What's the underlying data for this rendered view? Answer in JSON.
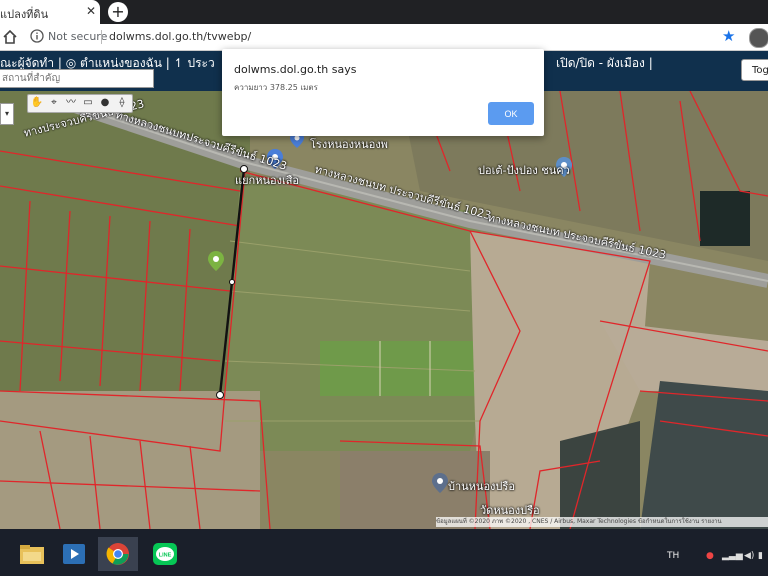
{
  "browser": {
    "tab_title": "แปลงที่ดิน",
    "close_glyph": "✕",
    "newtab_glyph": "+",
    "not_secure": "Not secure",
    "url": "dolwms.dol.go.th/tvwebp/",
    "star_glyph": "★"
  },
  "site_nav": {
    "left_text": "ณะผู้จัดทำ | ◎ ตำแหน่งของฉัน | ↿ ประว",
    "right_text": "เปิด/ปิด - ผังเมือง |",
    "toggle_label": "Tog",
    "search_placeholder": "สถานที่สำคัญ"
  },
  "map": {
    "road_label_1": "ทางหลวงชนบทประจวบคีรีขันธ์ 1023",
    "road_label_2": "ทางหลวงชนบท ประจวบคีรีขันธ์ 1023",
    "road_label_3": "ทางหลวงชนบท ประจวบคีรีขันธ์ 1023",
    "road_label_top": "ทางประจวบคีรีขันธ์ 1023",
    "place_1": "แยกหนองเสือ",
    "place_2": "ปอเต้-ปังปอง ชนคว",
    "place_3": "บ้านหนองปรือ",
    "place_4": "วัดหนองปรือ",
    "place_top": "โรงหนองหนองพ",
    "attribution": "ข้อมูลแผนที่ ©2020 ภาพ ©2020 , CNES / Airbus, Maxar Technologies  ข้อกำหนดในการใช้งาน  รายงาน",
    "layer_dropdown_glyph": "▾",
    "tools": [
      "✋",
      "⌖",
      "〰",
      "▭",
      "●",
      "⟠"
    ]
  },
  "dialog": {
    "title": "dolwms.dol.go.th says",
    "message": "ความยาว 378.25 เมตร",
    "ok_label": "OK"
  },
  "taskbar": {
    "apps": [
      "file-explorer-icon",
      "media-player-icon",
      "chrome-icon",
      "line-icon"
    ],
    "line_label": "LINE",
    "lang": "TH"
  },
  "colors": {
    "nav_bg": "#10304d",
    "parcel_line": "#e0262a",
    "ok_button": "#5b9bf0",
    "measure_line": "#111111"
  }
}
